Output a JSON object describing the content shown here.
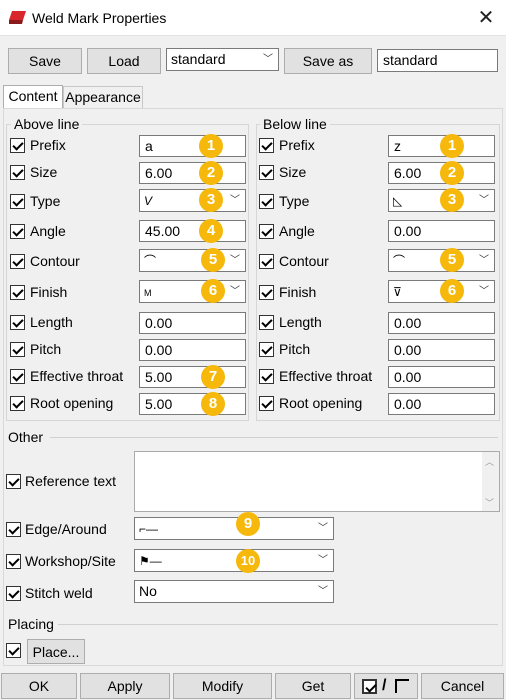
{
  "window": {
    "title": "Weld Mark Properties",
    "close_glyph": "✕"
  },
  "toolbar": {
    "save_label": "Save",
    "load_label": "Load",
    "preset_value": "standard",
    "save_as_label": "Save as",
    "save_as_name": "standard"
  },
  "tabs": [
    {
      "label": "Content",
      "active": true
    },
    {
      "label": "Appearance",
      "active": false
    }
  ],
  "above_line": {
    "title": "Above line",
    "prefix": {
      "label": "Prefix",
      "value": "a",
      "badge": "1"
    },
    "size": {
      "label": "Size",
      "value": "6.00",
      "badge": "2"
    },
    "type": {
      "label": "Type",
      "symbol": "V",
      "badge": "3"
    },
    "angle": {
      "label": "Angle",
      "value": "45.00",
      "badge": "4"
    },
    "contour": {
      "label": "Contour",
      "symbol": "⌒",
      "badge": "5"
    },
    "finish": {
      "label": "Finish",
      "symbol": "M",
      "badge": "6"
    },
    "length": {
      "label": "Length",
      "value": "0.00"
    },
    "pitch": {
      "label": "Pitch",
      "value": "0.00"
    },
    "effective_throat": {
      "label": "Effective throat",
      "value": "5.00",
      "badge": "7"
    },
    "root_opening": {
      "label": "Root opening",
      "value": "5.00",
      "badge": "8"
    }
  },
  "below_line": {
    "title": "Below line",
    "prefix": {
      "label": "Prefix",
      "value": "z",
      "badge": "1"
    },
    "size": {
      "label": "Size",
      "value": "6.00",
      "badge": "2"
    },
    "type": {
      "label": "Type",
      "symbol": "◺",
      "badge": "3"
    },
    "angle": {
      "label": "Angle",
      "value": "0.00"
    },
    "contour": {
      "label": "Contour",
      "symbol": "⌒",
      "badge": "5"
    },
    "finish": {
      "label": "Finish",
      "symbol": "⊽",
      "badge": "6"
    },
    "length": {
      "label": "Length",
      "value": "0.00"
    },
    "pitch": {
      "label": "Pitch",
      "value": "0.00"
    },
    "effective_throat": {
      "label": "Effective throat",
      "value": "0.00"
    },
    "root_opening": {
      "label": "Root opening",
      "value": "0.00"
    }
  },
  "other": {
    "title": "Other",
    "reference_text": {
      "label": "Reference text",
      "value": ""
    },
    "edge_around": {
      "label": "Edge/Around",
      "symbol": "⌐—",
      "badge": "9"
    },
    "workshop_site": {
      "label": "Workshop/Site",
      "symbol": "⚑—",
      "badge": "10"
    },
    "stitch_weld": {
      "label": "Stitch weld",
      "value": "No"
    }
  },
  "placing": {
    "title": "Placing",
    "place_label": "Place..."
  },
  "footer": {
    "ok_label": "OK",
    "apply_label": "Apply",
    "modify_label": "Modify",
    "get_label": "Get",
    "toggle_separator": "/",
    "cancel_label": "Cancel"
  },
  "colors": {
    "badge": "#f5b80b",
    "accent": "#0078d7",
    "icon_red": "#d9262c"
  }
}
